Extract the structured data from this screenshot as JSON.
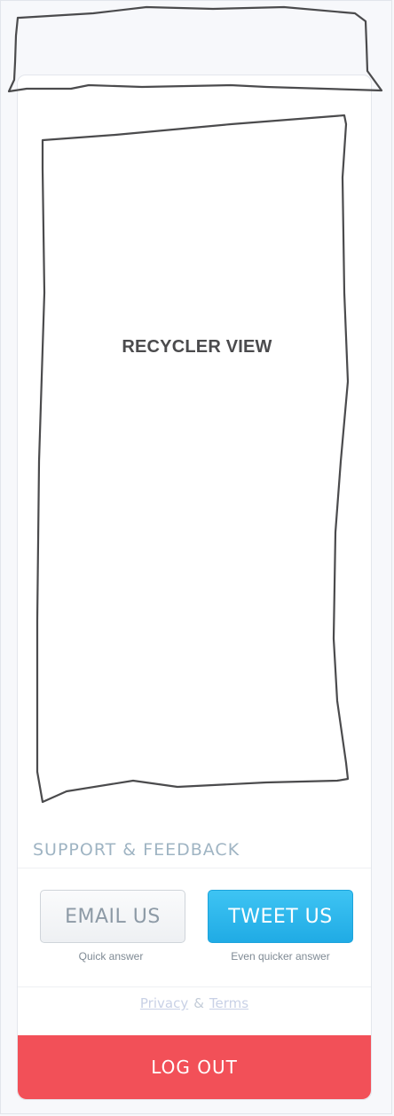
{
  "recycler": {
    "label": "RECYCLER VIEW"
  },
  "support": {
    "title": "SUPPORT & FEEDBACK",
    "email_button": "EMAIL US",
    "email_caption": "Quick answer",
    "tweet_button": "TWEET US",
    "tweet_caption": "Even quicker answer"
  },
  "footer": {
    "privacy": "Privacy",
    "ampersand": "&",
    "terms": "Terms"
  },
  "logout": {
    "label": "LOG OUT"
  },
  "colors": {
    "tweet_blue": "#29b6ee",
    "logout_red": "#f25058",
    "section_title": "#9fb4c3",
    "sketch_stroke": "#4b4b4d"
  }
}
